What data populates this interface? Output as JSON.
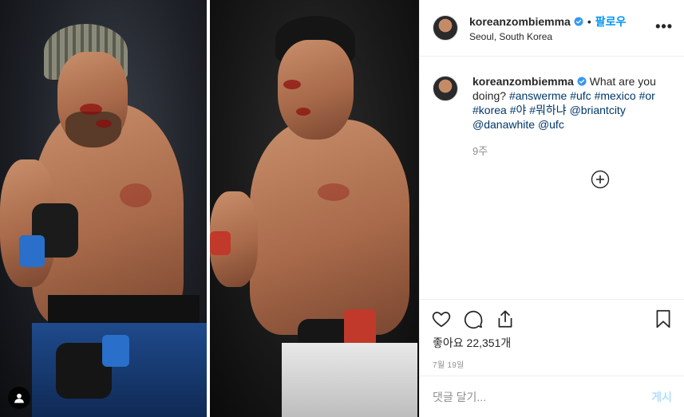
{
  "post": {
    "username": "koreanzombiemma",
    "verified": true,
    "follow_label": "팔로우",
    "location": "Seoul, South Korea",
    "more_icon": "more-icon"
  },
  "caption": {
    "text": "What are you doing?",
    "tags": [
      "#answerme",
      "#ufc",
      "#mexico",
      "#or",
      "#korea",
      "#야",
      "#뭐하냐",
      "@briantcity",
      "@danawhite",
      "@ufc"
    ],
    "age": "9주"
  },
  "actions": {
    "likes_label": "좋아요 22,351개",
    "date": "7월 19일"
  },
  "comment": {
    "placeholder": "댓글 달기...",
    "post_label": "게시"
  },
  "colors": {
    "accent": "#0095f6",
    "hashtag": "#00376b",
    "muted": "#8e8e8e",
    "post_disabled": "#b2dffc"
  }
}
